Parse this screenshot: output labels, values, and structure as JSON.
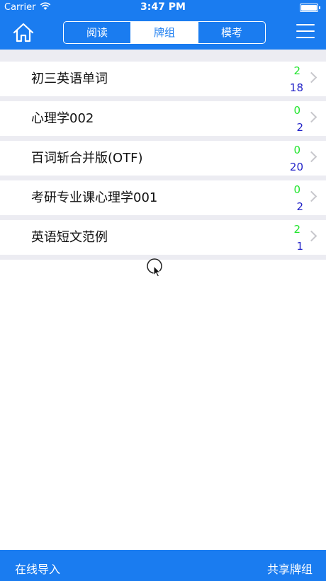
{
  "status_bar": {
    "carrier": "Carrier",
    "time": "3:47 PM",
    "battery_level": 1.0
  },
  "nav": {
    "home_icon": "house-icon",
    "menu_icon": "hamburger-menu-icon",
    "tabs": [
      {
        "label": "阅读",
        "active": false
      },
      {
        "label": "牌组",
        "active": true
      },
      {
        "label": "模考",
        "active": false
      }
    ]
  },
  "decks": [
    {
      "name": "初三英语单词",
      "count_top": "2",
      "count_bottom": "18"
    },
    {
      "name": "心理学002",
      "count_top": "0",
      "count_bottom": "2"
    },
    {
      "name": "百词斩合并版(OTF)",
      "count_top": "0",
      "count_bottom": "20"
    },
    {
      "name": "考研专业课心理学001",
      "count_top": "0",
      "count_bottom": "2"
    },
    {
      "name": "英语短文范例",
      "count_top": "2",
      "count_bottom": "1"
    }
  ],
  "bottom_bar": {
    "left_label": "在线导入",
    "right_label": "共享牌组"
  },
  "colors": {
    "brand_blue": "#1a7cf0",
    "count_top_green": "#21e52d",
    "count_bottom_blue": "#2323c8",
    "list_background": "#ececf2"
  }
}
